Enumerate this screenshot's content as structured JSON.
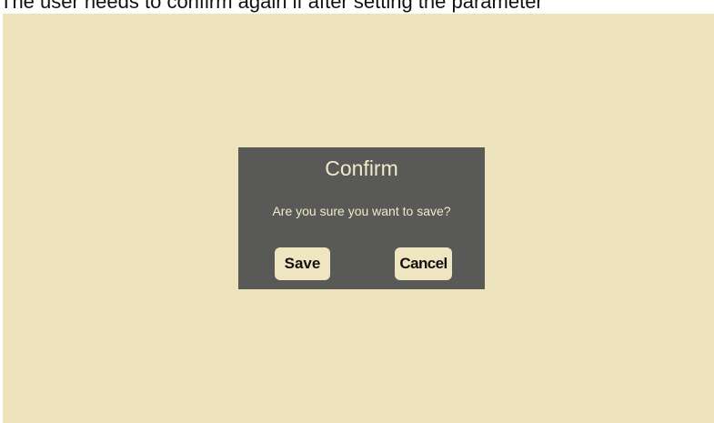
{
  "caption": {
    "text": "The user needs to confirm again if after setting the parameter"
  },
  "dialog": {
    "title": "Confirm",
    "message": "Are you sure you want to save?",
    "save_label": "Save",
    "cancel_label": "Cancel"
  },
  "colors": {
    "stage_background": "#ede4be",
    "dialog_background": "#595a58",
    "dialog_text": "#f1e9c7",
    "button_background": "#efe5c1"
  }
}
